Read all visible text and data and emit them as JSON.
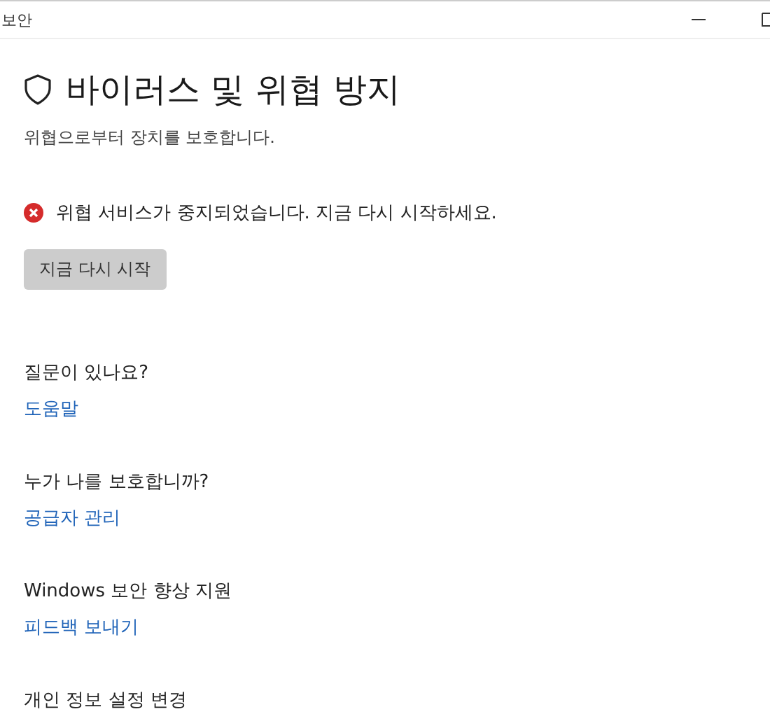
{
  "window": {
    "title": "보안"
  },
  "page": {
    "title": "바이러스 및 위협 방지",
    "subtitle": "위협으로부터 장치를 보호합니다."
  },
  "alert": {
    "kind": "error",
    "message": "위협 서비스가 중지되었습니다. 지금 다시 시작하세요.",
    "button": "지금 다시 시작"
  },
  "sections": [
    {
      "heading": "질문이 있나요?",
      "link": "도움말"
    },
    {
      "heading": "누가 나를 보호합니까?",
      "link": "공급자 관리"
    },
    {
      "heading": "Windows 보안 향상 지원",
      "link": "피드백 보내기"
    },
    {
      "heading": "개인 정보 설정 변경"
    }
  ]
}
